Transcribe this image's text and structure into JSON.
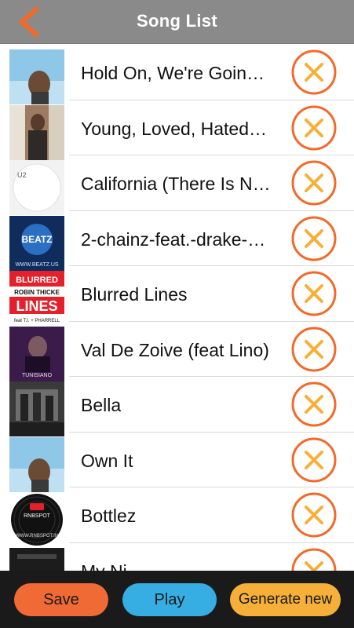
{
  "header": {
    "title": "Song List",
    "back_icon": "chevron-left-icon"
  },
  "colors": {
    "accent": "#f26a2a",
    "remove_x": "#f6b03a",
    "header_bg": "#8a8a8a",
    "footer_bg": "#1a1a1a",
    "save": "#f06a36",
    "play": "#37aee3",
    "generate": "#f6b03a"
  },
  "songs": [
    {
      "title": "Hold On, We're Goin…",
      "remove_icon": "remove-x-icon"
    },
    {
      "title": "Young, Loved, Hated…",
      "remove_icon": "remove-x-icon"
    },
    {
      "title": "California (There Is N…",
      "remove_icon": "remove-x-icon"
    },
    {
      "title": "2-chainz-feat.-drake-…",
      "remove_icon": "remove-x-icon"
    },
    {
      "title": "Blurred Lines",
      "remove_icon": "remove-x-icon"
    },
    {
      "title": "Val De Zoive (feat Lino)",
      "remove_icon": "remove-x-icon"
    },
    {
      "title": "Bella",
      "remove_icon": "remove-x-icon"
    },
    {
      "title": "Own It",
      "remove_icon": "remove-x-icon"
    },
    {
      "title": "Bottlez",
      "remove_icon": "remove-x-icon"
    },
    {
      "title": "My Ni…",
      "remove_icon": "remove-x-icon"
    }
  ],
  "artwork_text": {
    "u2": "U2",
    "beatz": "BEATZ",
    "beatz_url": "WWW.BEATZ.US",
    "blurred": "BLURRED",
    "robin": "ROBIN THICKE",
    "lines": "LINES",
    "feat": "feat T.I. + PHARRELL",
    "tunisiano": "TUNISIANO",
    "rnbspot": "RNBSPOT",
    "rnbspot_url": "WWW.RNBSPOT.IN"
  },
  "footer": {
    "save_label": "Save",
    "play_label": "Play",
    "generate_label": "Generate new"
  }
}
